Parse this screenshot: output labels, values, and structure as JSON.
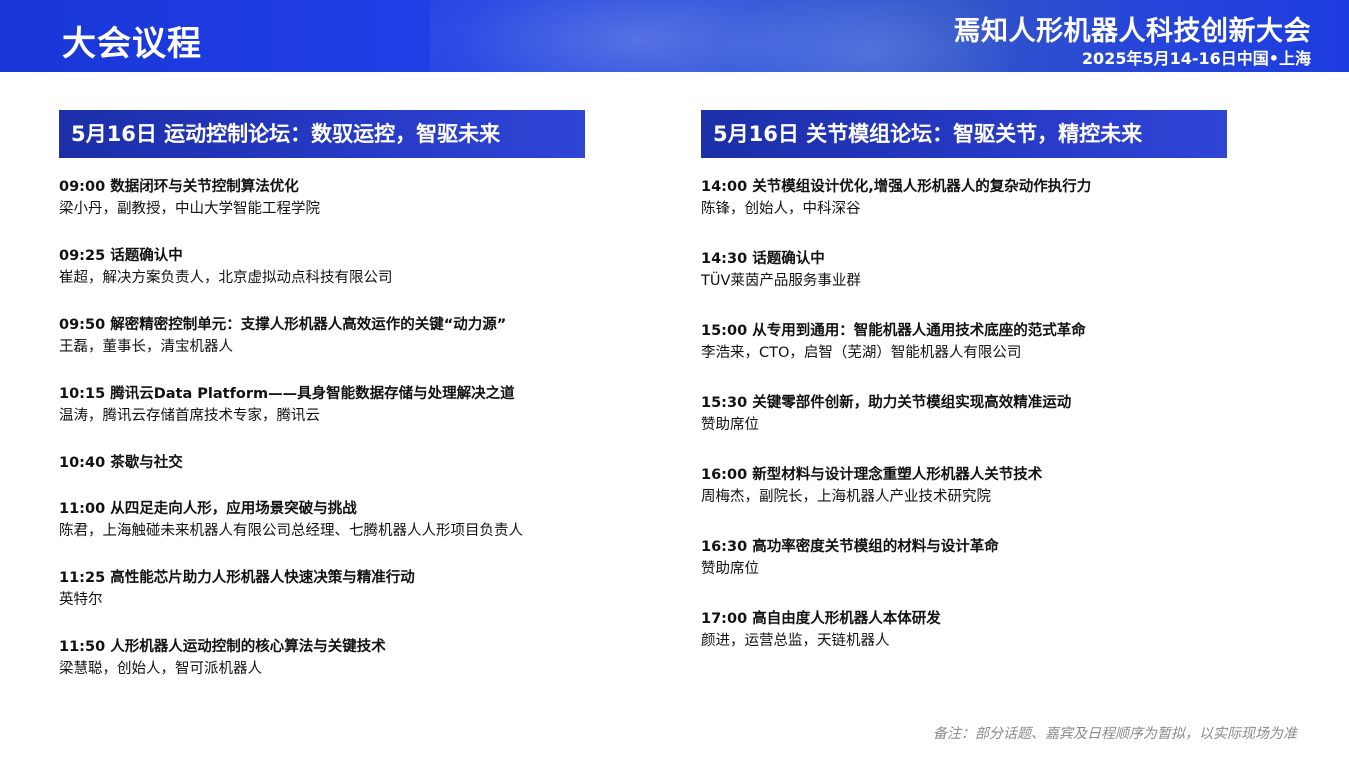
{
  "header": {
    "page_title": "大会议程",
    "conference_name": "焉知人形机器人科技创新大会",
    "conference_date": "2025年5月14-16日中国•上海"
  },
  "left": {
    "forum_title": "5月16日 运动控制论坛：数驭运控，智驱未来",
    "items": [
      {
        "title": "09:00 数据闭环与关节控制算法优化",
        "speaker": "梁小丹，副教授，中山大学智能工程学院"
      },
      {
        "title": "09:25 话题确认中",
        "speaker": "崔超，解决方案负责人，北京虚拟动点科技有限公司"
      },
      {
        "title": "09:50 解密精密控制单元：支撑人形机器人高效运作的关键“动力源”",
        "speaker": "王磊，董事长，清宝机器人"
      },
      {
        "title": "10:15 腾讯云Data Platform——具身智能数据存储与处理解决之道",
        "speaker": "温涛，腾讯云存储首席技术专家，腾讯云"
      },
      {
        "title": "10:40 茶歇与社交",
        "speaker": ""
      },
      {
        "title": "11:00  从四足走向人形，应用场景突破与挑战",
        "speaker": "陈君，上海触碰未来机器人有限公司总经理、七腾机器人人形项目负责人"
      },
      {
        "title": "11:25 高性能芯片助力人形机器人快速决策与精准行动",
        "speaker": "英特尔"
      },
      {
        "title": "11:50 人形机器人运动控制的核心算法与关键技术",
        "speaker": "梁慧聪，创始人，智可派机器人"
      }
    ]
  },
  "right": {
    "forum_title": "5月16日 关节模组论坛：智驱关节，精控未来",
    "items": [
      {
        "title": "14:00 关节模组设计优化,增强人形机器人的复杂动作执行力",
        "speaker": "陈锋，创始人，中科深谷"
      },
      {
        "title": "14:30 话题确认中",
        "speaker": "TÜV莱茵产品服务事业群"
      },
      {
        "title": "15:00 从专用到通用：智能机器人通用技术底座的范式革命",
        "speaker": "李浩来，CTO，启智（芜湖）智能机器人有限公司"
      },
      {
        "title": "15:30 关键零部件创新，助力关节模组实现高效精准运动",
        "speaker": "赞助席位"
      },
      {
        "title": "16:00 新型材料与设计理念重塑人形机器人关节技术",
        "speaker": "周梅杰，副院长，上海机器人产业技术研究院"
      },
      {
        "title": "16:30 高功率密度关节模组的材料与设计革命",
        "speaker": "赞助席位"
      },
      {
        "title": "17:00 高自由度人形机器人本体研发",
        "speaker": "颜进，运营总监，天链机器人"
      }
    ]
  },
  "footnote": "备注：部分话题、嘉宾及日程顺序为暂拟，以实际现场为准"
}
